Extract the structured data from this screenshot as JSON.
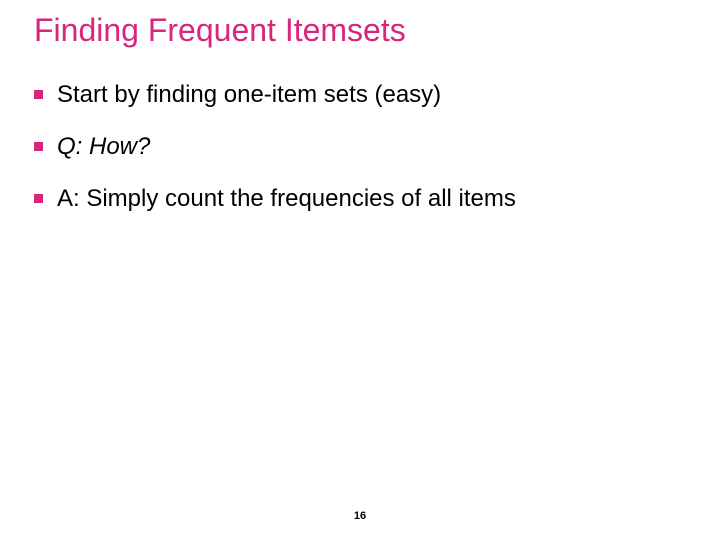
{
  "colors": {
    "accent": "#d8267d",
    "bullet": "#d8267d"
  },
  "title": "Finding Frequent Itemsets",
  "bullets": [
    {
      "text": "Start by finding one-item sets (easy)",
      "italic": false
    },
    {
      "text": "Q: How?",
      "italic": true
    },
    {
      "text": "A: Simply count the frequencies of all items",
      "italic": false
    }
  ],
  "page_number": "16"
}
